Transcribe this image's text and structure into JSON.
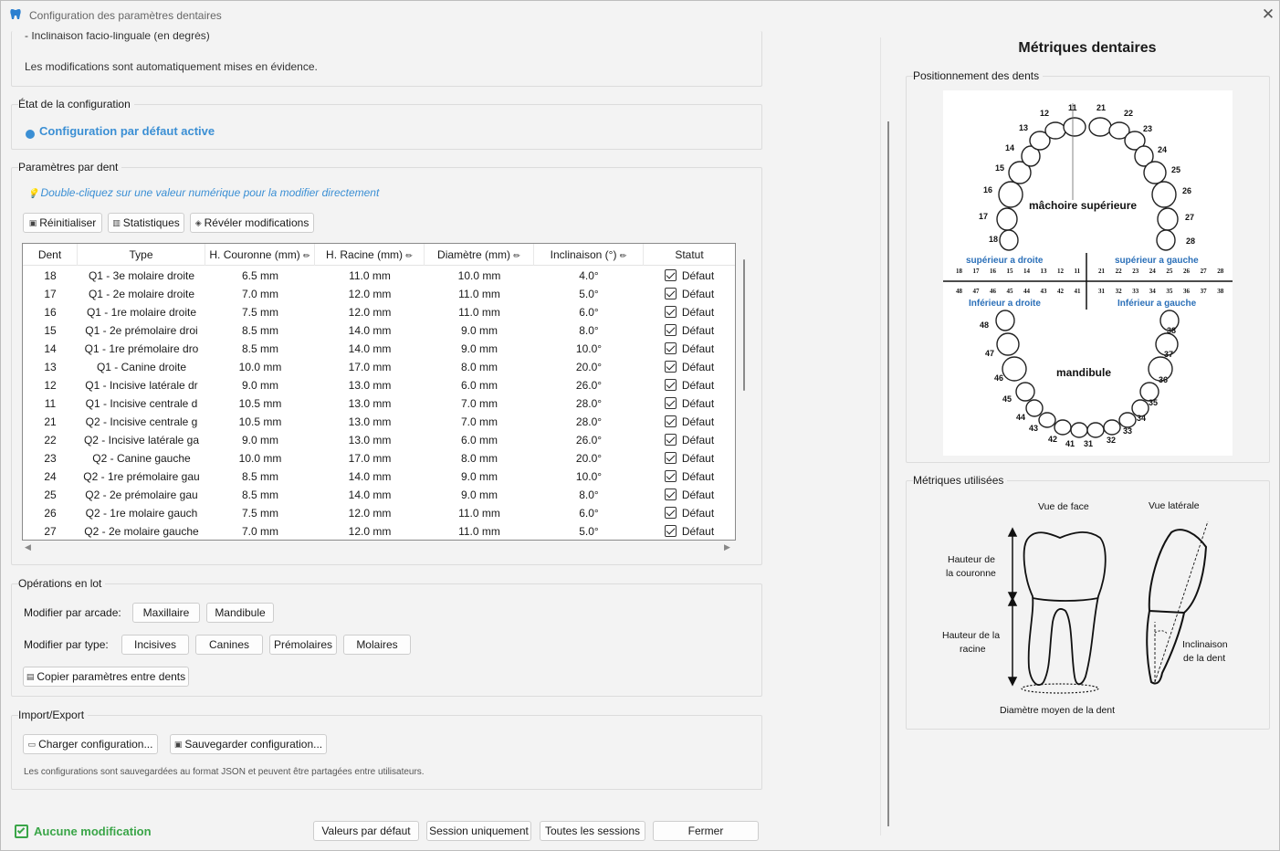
{
  "window": {
    "title": "Configuration des paramètres dentaires",
    "close_icon": "close-icon"
  },
  "info": {
    "line_partial": "- Inclinaison facio-linguale (en degrés)",
    "note": "Les modifications sont automatiquement mises en évidence."
  },
  "config_state": {
    "group_label": "État de la configuration",
    "status": "Configuration par défaut active",
    "status_color": "#3b8fd4"
  },
  "per_tooth": {
    "group_label": "Paramètres par dent",
    "hint": "Double-cliquez sur une valeur numérique pour la modifier directement",
    "buttons": {
      "reset": "Réinitialiser",
      "stats": "Statistiques",
      "reveal": "Révéler modifications"
    },
    "columns": [
      "Dent",
      "Type",
      "H. Couronne (mm)",
      "H. Racine (mm)",
      "Diamètre (mm)",
      "Inclinaison (°)",
      "Statut"
    ],
    "rows": [
      [
        "18",
        "Q1 - 3e molaire droite",
        "6.5 mm",
        "11.0 mm",
        "10.0 mm",
        "4.0°",
        "Défaut"
      ],
      [
        "17",
        "Q1 - 2e molaire droite",
        "7.0 mm",
        "12.0 mm",
        "11.0 mm",
        "5.0°",
        "Défaut"
      ],
      [
        "16",
        "Q1 - 1re molaire droite",
        "7.5 mm",
        "12.0 mm",
        "11.0 mm",
        "6.0°",
        "Défaut"
      ],
      [
        "15",
        "Q1 - 2e prémolaire droi",
        "8.5 mm",
        "14.0 mm",
        "9.0 mm",
        "8.0°",
        "Défaut"
      ],
      [
        "14",
        "Q1 - 1re prémolaire dro",
        "8.5 mm",
        "14.0 mm",
        "9.0 mm",
        "10.0°",
        "Défaut"
      ],
      [
        "13",
        "Q1 - Canine droite",
        "10.0 mm",
        "17.0 mm",
        "8.0 mm",
        "20.0°",
        "Défaut"
      ],
      [
        "12",
        "Q1 - Incisive latérale dr",
        "9.0 mm",
        "13.0 mm",
        "6.0 mm",
        "26.0°",
        "Défaut"
      ],
      [
        "11",
        "Q1 - Incisive centrale d",
        "10.5 mm",
        "13.0 mm",
        "7.0 mm",
        "28.0°",
        "Défaut"
      ],
      [
        "21",
        "Q2 - Incisive centrale g",
        "10.5 mm",
        "13.0 mm",
        "7.0 mm",
        "28.0°",
        "Défaut"
      ],
      [
        "22",
        "Q2 - Incisive latérale ga",
        "9.0 mm",
        "13.0 mm",
        "6.0 mm",
        "26.0°",
        "Défaut"
      ],
      [
        "23",
        "Q2 - Canine gauche",
        "10.0 mm",
        "17.0 mm",
        "8.0 mm",
        "20.0°",
        "Défaut"
      ],
      [
        "24",
        "Q2 - 1re prémolaire gau",
        "8.5 mm",
        "14.0 mm",
        "9.0 mm",
        "10.0°",
        "Défaut"
      ],
      [
        "25",
        "Q2 - 2e prémolaire gau",
        "8.5 mm",
        "14.0 mm",
        "9.0 mm",
        "8.0°",
        "Défaut"
      ],
      [
        "26",
        "Q2 - 1re molaire gauch",
        "7.5 mm",
        "12.0 mm",
        "11.0 mm",
        "6.0°",
        "Défaut"
      ],
      [
        "27",
        "Q2 - 2e molaire gauche",
        "7.0 mm",
        "12.0 mm",
        "11.0 mm",
        "5.0°",
        "Défaut"
      ]
    ]
  },
  "batch": {
    "group_label": "Opérations en lot",
    "by_arch_label": "Modifier par arcade:",
    "arch_buttons": [
      "Maxillaire",
      "Mandibule"
    ],
    "by_type_label": "Modifier par type:",
    "type_buttons": [
      "Incisives",
      "Canines",
      "Prémolaires",
      "Molaires"
    ],
    "copy_button": "Copier paramètres entre dents"
  },
  "import_export": {
    "group_label": "Import/Export",
    "load_button": "Charger configuration...",
    "save_button": "Sauvegarder configuration...",
    "note": "Les configurations sont sauvegardées au format JSON et peuvent être partagées entre utilisateurs."
  },
  "footer": {
    "status": "Aucune modification",
    "status_color": "#3aa548",
    "buttons": [
      "Valeurs par défaut",
      "Session uniquement",
      "Toutes les sessions",
      "Fermer"
    ]
  },
  "metrics": {
    "title": "Métriques dentaires",
    "positioning_label": "Positionnement des dents",
    "chart": {
      "upper_label": "mâchoire supérieure",
      "lower_label": "mandibule",
      "upper_right": "supérieur a droite",
      "upper_left": "supérieur a gauche",
      "lower_right": "Inférieur a droite",
      "lower_left": "Inférieur a gauche",
      "upper_row": [
        "18",
        "17",
        "16",
        "15",
        "14",
        "13",
        "12",
        "11",
        "21",
        "22",
        "23",
        "24",
        "25",
        "26",
        "27",
        "28"
      ],
      "lower_row": [
        "48",
        "47",
        "46",
        "45",
        "44",
        "43",
        "42",
        "41",
        "31",
        "32",
        "33",
        "34",
        "35",
        "36",
        "37",
        "38"
      ]
    },
    "used_label": "Métriques utilisées",
    "diagram": {
      "front_view": "Vue de face",
      "side_view": "Vue latérale",
      "crown_height": "Hauteur de la couronne",
      "root_height": "Hauteur de la racine",
      "inclination": "Inclinaison de la dent",
      "diameter": "Diamètre moyen de la dent"
    }
  }
}
